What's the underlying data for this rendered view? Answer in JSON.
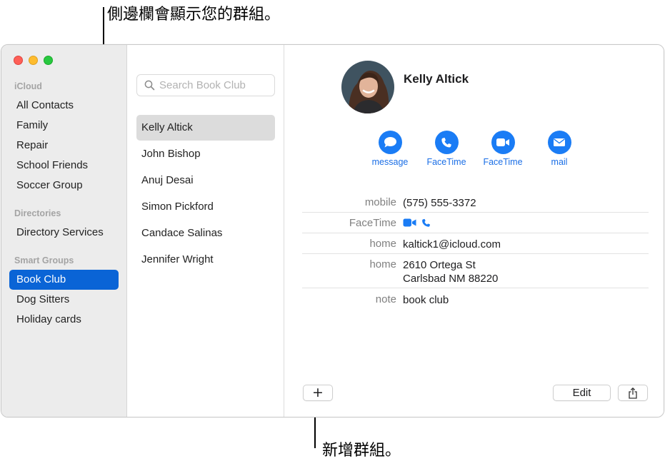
{
  "annotations": {
    "sidebar_callout": "側邊欄會顯示您的群組。",
    "add_group_callout": "新增群組。"
  },
  "sidebar": {
    "sections": [
      {
        "title": "iCloud",
        "items": [
          "All Contacts",
          "Family",
          "Repair",
          "School Friends",
          "Soccer Group"
        ]
      },
      {
        "title": "Directories",
        "items": [
          "Directory Services"
        ]
      },
      {
        "title": "Smart Groups",
        "items": [
          "Book Club",
          "Dog Sitters",
          "Holiday cards"
        ]
      }
    ],
    "selected": "Book Club"
  },
  "list": {
    "search_placeholder": "Search Book Club",
    "contacts": [
      "Kelly Altick",
      "John Bishop",
      "Anuj Desai",
      "Simon Pickford",
      "Candace Salinas",
      "Jennifer Wright"
    ],
    "selected": "Kelly Altick"
  },
  "detail": {
    "name": "Kelly Altick",
    "actions": [
      "message",
      "FaceTime",
      "FaceTime",
      "mail"
    ],
    "fields": {
      "mobile": {
        "label": "mobile",
        "value": "(575) 555-3372"
      },
      "facetime": {
        "label": "FaceTime"
      },
      "email": {
        "label": "home",
        "value": "kaltick1@icloud.com"
      },
      "address": {
        "label": "home",
        "line1": "2610 Ortega St",
        "line2": "Carlsbad NM 88220"
      },
      "note": {
        "label": "note",
        "value": "book club"
      }
    }
  },
  "toolbar": {
    "add_label": "+",
    "edit_label": "Edit"
  },
  "colors": {
    "accent": "#0a64d6",
    "action_blue": "#1a7cf5",
    "sidebar_bg": "#ececec"
  },
  "icons": [
    "search-icon",
    "message-icon",
    "phone-icon",
    "video-icon",
    "mail-icon",
    "share-icon"
  ]
}
